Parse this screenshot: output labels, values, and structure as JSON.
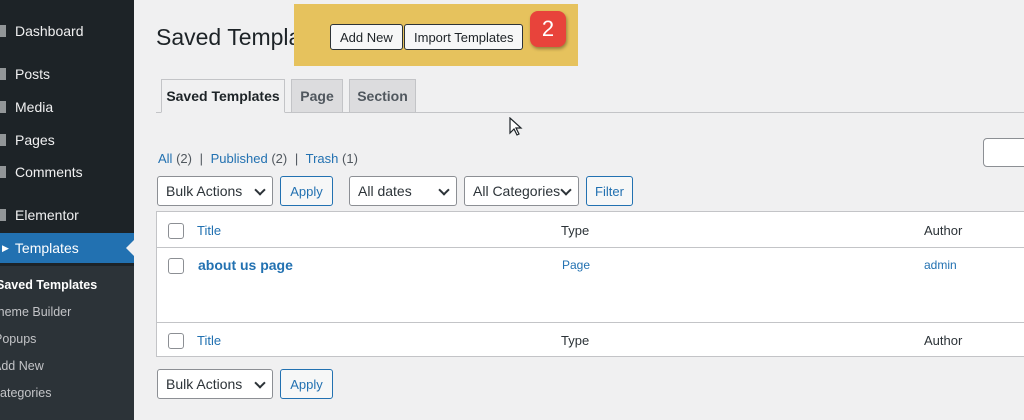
{
  "sidebar": {
    "items": [
      {
        "label": "Dashboard"
      },
      {
        "label": "Posts"
      },
      {
        "label": "Media"
      },
      {
        "label": "Pages"
      },
      {
        "label": "Comments"
      },
      {
        "label": "Elementor"
      },
      {
        "label": "Templates"
      }
    ],
    "submenu": [
      {
        "label": "Saved Templates"
      },
      {
        "label": "Theme Builder"
      },
      {
        "label": "Popups"
      },
      {
        "label": "Add New"
      },
      {
        "label": "Categories"
      }
    ]
  },
  "header": {
    "title": "Saved Templates",
    "add_new": "Add New",
    "import": "Import Templates",
    "badge": "2"
  },
  "tabs": [
    {
      "label": "Saved Templates",
      "active": true
    },
    {
      "label": "Page",
      "active": false
    },
    {
      "label": "Section",
      "active": false
    }
  ],
  "views": {
    "all": "All",
    "all_count": "(2)",
    "published": "Published",
    "published_count": "(2)",
    "trash": "Trash",
    "trash_count": "(1)",
    "separator": "|"
  },
  "filters": {
    "bulk_actions": "Bulk Actions",
    "apply": "Apply",
    "dates": "All dates",
    "categories": "All Categories",
    "filter": "Filter"
  },
  "table": {
    "columns": [
      "Title",
      "Type",
      "Author"
    ],
    "rows": [
      {
        "title": "about us page",
        "type": "Page",
        "author": "admin"
      }
    ]
  },
  "colors": {
    "sidebar_bg": "#1d2327",
    "accent": "#2271b1",
    "highlight": "#e6c25d",
    "badge": "#e8433b"
  }
}
